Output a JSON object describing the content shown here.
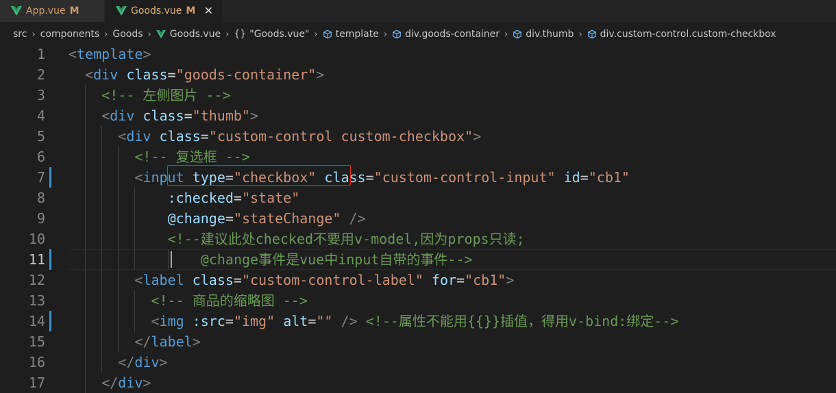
{
  "tabs": [
    {
      "label": "App.vue",
      "modified": "M"
    },
    {
      "label": "Goods.vue",
      "modified": "M",
      "close": "✕"
    }
  ],
  "breadcrumb": {
    "src": "src",
    "components": "components",
    "goods": "Goods",
    "file": "Goods.vue",
    "braces": "{}",
    "symbol": "\"Goods.vue\"",
    "template": "template",
    "container": "div.goods-container",
    "thumb": "div.thumb",
    "checkbox": "div.custom-control.custom-checkbox"
  },
  "editor": {
    "active_line": 11,
    "lines": [
      {
        "n": "1",
        "p": [
          "<",
          "template",
          ">"
        ]
      },
      {
        "n": "2",
        "p": [
          "<",
          "div",
          " ",
          "class",
          "=",
          "\"goods-container\"",
          ">"
        ]
      },
      {
        "n": "3",
        "p": [
          "<!-- 左侧图片 -->"
        ]
      },
      {
        "n": "4",
        "p": [
          "<",
          "div",
          " ",
          "class",
          "=",
          "\"thumb\"",
          ">"
        ]
      },
      {
        "n": "5",
        "p": [
          "<",
          "div",
          " ",
          "class",
          "=",
          "\"custom-control custom-checkbox\"",
          ">"
        ]
      },
      {
        "n": "6",
        "p": [
          "<!-- 复选框 -->"
        ]
      },
      {
        "n": "7",
        "p": [
          "<",
          "input",
          " ",
          "type",
          "=",
          "\"checkbox\"",
          " ",
          "class",
          "=",
          "\"custom-control-input\"",
          " ",
          "id",
          "=",
          "\"cb1\""
        ]
      },
      {
        "n": "8",
        "p": [
          ":checked",
          "=",
          "\"state\""
        ]
      },
      {
        "n": "9",
        "p": [
          "@change",
          "=",
          "\"stateChange\"",
          " ",
          "/>"
        ]
      },
      {
        "n": "10",
        "p": [
          "<!--建议此处checked不要用v-model,因为props只读;"
        ]
      },
      {
        "n": "11",
        "p": [
          "@change事件是vue中input自带的事件-->"
        ]
      },
      {
        "n": "12",
        "p": [
          "<",
          "label",
          " ",
          "class",
          "=",
          "\"custom-control-label\"",
          " ",
          "for",
          "=",
          "\"cb1\"",
          ">"
        ]
      },
      {
        "n": "13",
        "p": [
          "<!-- 商品的缩略图 -->"
        ]
      },
      {
        "n": "14",
        "p": [
          "<",
          "img",
          " ",
          ":src",
          "=",
          "\"img\"",
          " ",
          "alt",
          "=",
          "\"\"",
          " ",
          "/>",
          " ",
          "<!--属性不能用{{}}插值，得用v-bind:绑定-->"
        ]
      },
      {
        "n": "15",
        "p": [
          "</",
          "label",
          ">"
        ]
      },
      {
        "n": "16",
        "p": [
          "</",
          "div",
          ">"
        ]
      },
      {
        "n": "17",
        "p": [
          "</",
          "div",
          ">"
        ]
      }
    ]
  },
  "colors": {
    "background": "#1e1e1e",
    "tag": "#569cd6",
    "attribute": "#9cdcfe",
    "string": "#ce9178",
    "comment": "#6a9955",
    "highlight_box": "#e0301e",
    "vue_green": "#41b883"
  }
}
